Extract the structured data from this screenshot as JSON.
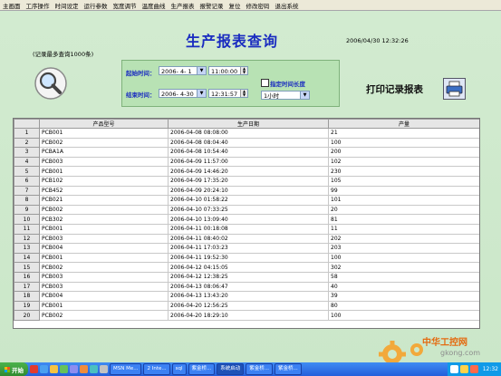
{
  "menu": [
    "主画面",
    "工序操作",
    "时间设定",
    "运行参数",
    "宽度调节",
    "温度曲线",
    "生产报表",
    "报警记录",
    "复位",
    "修改密码",
    "退出系统"
  ],
  "title": "生产报表查询",
  "datetime": "2006/04/30   12:32:26",
  "limit_note": "(记录最多查询1000条)",
  "filter": {
    "start_label": "起始时间：",
    "start_date": "2006- 4- 1",
    "start_time": "11:00:00",
    "end_label": "结束时间：",
    "end_date": "2006- 4-30",
    "end_time": "12:31:57",
    "fixed_label": "指定时间长度",
    "duration": "1小时"
  },
  "print_label": "打印记录报表",
  "table": {
    "headers": [
      "",
      "产品型号",
      "生产日期",
      "产量"
    ],
    "rows": [
      [
        "1",
        "PCB001",
        "2006-04-08 08:08:00",
        "21"
      ],
      [
        "2",
        "PCB002",
        "2006-04-08 08:04:40",
        "100"
      ],
      [
        "3",
        "PCBA1A",
        "2006-04-08 10:54:40",
        "200"
      ],
      [
        "4",
        "PCB003",
        "2006-04-09 11:57:00",
        "102"
      ],
      [
        "5",
        "PCB001",
        "2006-04-09 14:46:20",
        "230"
      ],
      [
        "6",
        "PCB102",
        "2006-04-09 17:35:20",
        "105"
      ],
      [
        "7",
        "PCB452",
        "2006-04-09 20:24:10",
        "99"
      ],
      [
        "8",
        "PCB021",
        "2006-04-10 01:58:22",
        "101"
      ],
      [
        "9",
        "PCB002",
        "2006-04-10 07:33:25",
        "20"
      ],
      [
        "10",
        "PCB302",
        "2006-04-10 13:09:40",
        "81"
      ],
      [
        "11",
        "PCB001",
        "2006-04-11 00:18:08",
        "11"
      ],
      [
        "12",
        "PCB003",
        "2006-04-11 08:40:02",
        "202"
      ],
      [
        "13",
        "PCB004",
        "2006-04-11 17:03:23",
        "203"
      ],
      [
        "14",
        "PCB001",
        "2006-04-11 19:52:30",
        "100"
      ],
      [
        "15",
        "PCB002",
        "2006-04-12 04:15:05",
        "302"
      ],
      [
        "16",
        "PCB003",
        "2006-04-12 12:38:25",
        "58"
      ],
      [
        "17",
        "PCB003",
        "2006-04-13 08:06:47",
        "40"
      ],
      [
        "18",
        "PCB004",
        "2006-04-13 13:43:20",
        "39"
      ],
      [
        "19",
        "PCB001",
        "2006-04-20 12:56:25",
        "80"
      ],
      [
        "20",
        "PCB002",
        "2006-04-20 18:29:10",
        "100"
      ]
    ]
  },
  "watermark": {
    "name": "中华工控网",
    "url": "gkong.com"
  },
  "taskbar": {
    "start": "开始",
    "items": [
      "MSN Me...",
      "2 Inte...",
      "sql",
      "紫金桥...",
      "系统启动",
      "紫金桥...",
      "紫金桥..."
    ],
    "active_index": 4,
    "clock": "12:32"
  }
}
